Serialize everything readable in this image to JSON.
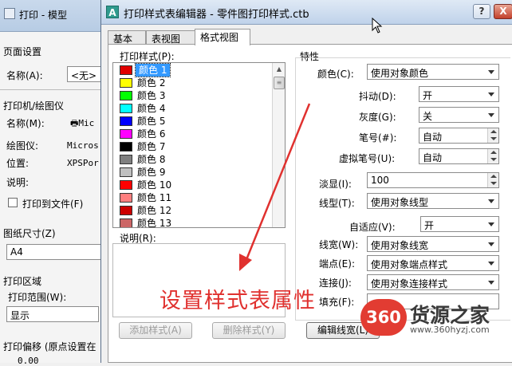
{
  "bg_dialog": {
    "title": "打印 - 模型",
    "page_setup": "页面设置",
    "name_label": "名称(A):",
    "name_value": "<无>",
    "printer_heading": "打印机/绘图仪",
    "printer_name_label": "名称(M):",
    "printer_name_value": "Mic",
    "plotter_label": "绘图仪:",
    "plotter_value": "Micros",
    "location_label": "位置:",
    "location_value": "XPSPor",
    "desc_label": "说明:",
    "print_to_file": "打印到文件(F)",
    "paper_size_label": "图纸尺寸(Z)",
    "paper_size_value": "A4",
    "print_area_heading": "打印区域",
    "print_range_label": "打印范围(W):",
    "print_range_value": "显示",
    "print_offset": "打印偏移 (原点设置在",
    "offset_value": "0.00"
  },
  "dialog": {
    "title": "打印样式表编辑器 - 零件图打印样式.ctb",
    "help": "?",
    "close": "X"
  },
  "tabs": [
    {
      "label": "基本"
    },
    {
      "label": "表视图"
    },
    {
      "label": "格式视图"
    }
  ],
  "styles_label": "打印样式(P):",
  "styles": [
    {
      "name": "颜色 1",
      "color": "#e00000"
    },
    {
      "name": "颜色 2",
      "color": "#ffff00"
    },
    {
      "name": "颜色 3",
      "color": "#00ff00"
    },
    {
      "name": "颜色 4",
      "color": "#00ffff"
    },
    {
      "name": "颜色 5",
      "color": "#0000ff"
    },
    {
      "name": "颜色 6",
      "color": "#ff00ff"
    },
    {
      "name": "颜色 7",
      "color": "#000000"
    },
    {
      "name": "颜色 8",
      "color": "#808080"
    },
    {
      "name": "颜色 9",
      "color": "#c0c0c0"
    },
    {
      "name": "颜色 10",
      "color": "#ff0000"
    },
    {
      "name": "颜色 11",
      "color": "#ff7f7f"
    },
    {
      "name": "颜色 12",
      "color": "#cc0000"
    },
    {
      "name": "颜色 13",
      "color": "#cc6666"
    }
  ],
  "description_label": "说明(R):",
  "buttons": {
    "add_style": "添加样式(A)",
    "delete_style": "删除样式(Y)",
    "edit_lineweight": "编辑线宽(L)"
  },
  "properties": {
    "heading": "特性",
    "color_label": "颜色(C):",
    "color_value": "使用对象颜色",
    "dither_label": "抖动(D):",
    "dither_value": "开",
    "grayscale_label": "灰度(G):",
    "grayscale_value": "关",
    "pen_label": "笔号(#):",
    "pen_value": "自动",
    "vpen_label": "虚拟笔号(U):",
    "vpen_value": "自动",
    "screening_label": "淡显(I):",
    "screening_value": "100",
    "linetype_label": "线型(T):",
    "linetype_value": "使用对象线型",
    "adaptive_label": "自适应(V):",
    "adaptive_value": "开",
    "lineweight_label": "线宽(W):",
    "lineweight_value": "使用对象线宽",
    "endstyle_label": "端点(E):",
    "endstyle_value": "使用对象端点样式",
    "joinstyle_label": "连接(J):",
    "joinstyle_value": "使用对象连接样式",
    "fill_label": "填充(F):",
    "fill_value": ""
  },
  "annotation": "设置样式表属性",
  "watermark": {
    "badge": "360",
    "text": "货源之家",
    "url": "www.360hyzj.com"
  },
  "colors": {
    "annotation": "#e0312f",
    "selection": "#3399ff",
    "badge": "#e23c32"
  }
}
